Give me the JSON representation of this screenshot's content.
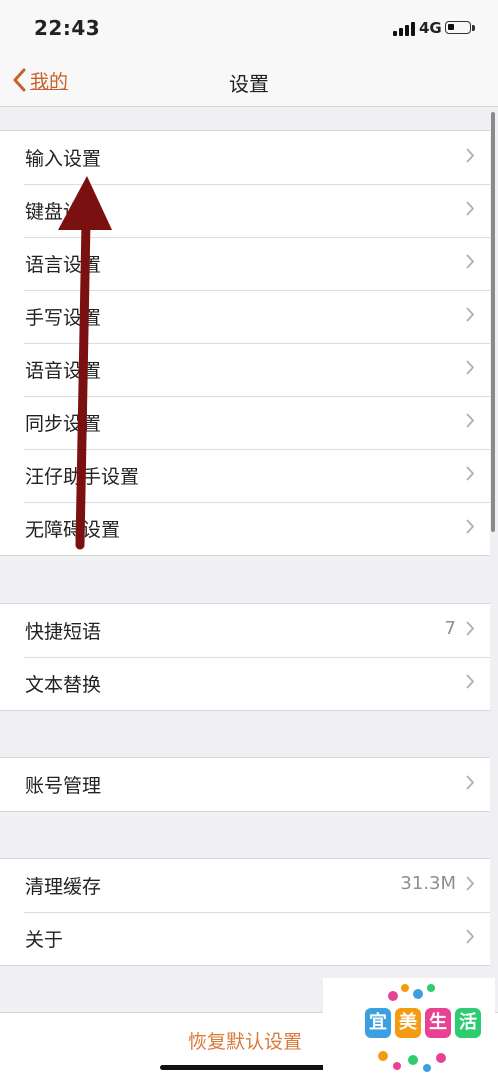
{
  "status_bar": {
    "time": "22:43",
    "network": "4G",
    "battery_level": 0.3
  },
  "nav": {
    "back_label": "我的",
    "title": "设置"
  },
  "groups": [
    {
      "items": [
        {
          "label": "输入设置"
        },
        {
          "label": "键盘设置"
        },
        {
          "label": "语言设置"
        },
        {
          "label": "手写设置"
        },
        {
          "label": "语音设置"
        },
        {
          "label": "同步设置"
        },
        {
          "label": "汪仔助手设置"
        },
        {
          "label": "无障碍设置"
        }
      ]
    },
    {
      "items": [
        {
          "label": "快捷短语",
          "value": "7"
        },
        {
          "label": "文本替换"
        }
      ]
    },
    {
      "items": [
        {
          "label": "账号管理"
        }
      ]
    },
    {
      "items": [
        {
          "label": "清理缓存",
          "value": "31.3M"
        },
        {
          "label": "关于"
        }
      ]
    }
  ],
  "footer": {
    "restore_label": "恢复默认设置"
  },
  "watermark": {
    "chars": [
      "宜",
      "美",
      "生",
      "活"
    ],
    "colors": [
      "#3aa0e0",
      "#f39c12",
      "#e84393",
      "#2ecc71"
    ]
  },
  "annotation": {
    "arrow_color": "#7b1010"
  },
  "colors": {
    "accent": "#c8622b",
    "background": "#efeff4"
  }
}
